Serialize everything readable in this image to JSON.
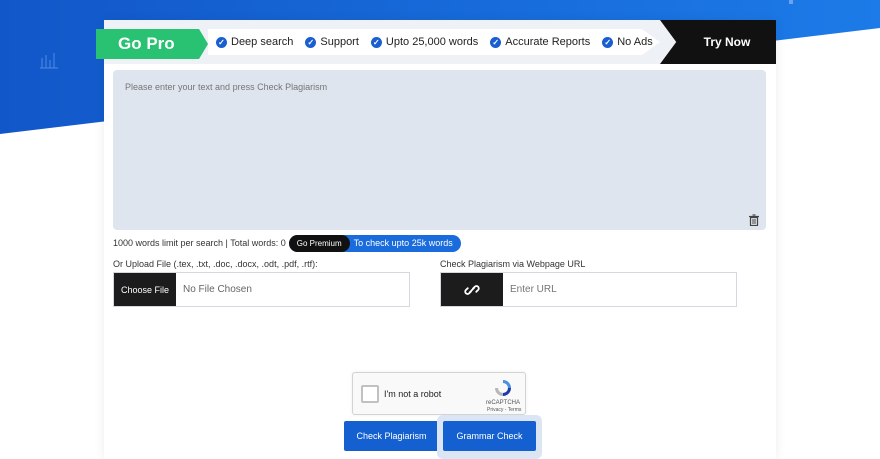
{
  "promo": {
    "go_pro_label": "Go Pro",
    "features": [
      {
        "label": "Deep search",
        "icon": "check-circle-icon"
      },
      {
        "label": "Support",
        "icon": "check-circle-icon"
      },
      {
        "label": "Upto 25,000 words",
        "icon": "check-circle-icon"
      },
      {
        "label": "Accurate Reports",
        "icon": "check-circle-icon"
      },
      {
        "label": "No Ads",
        "icon": "check-circle-icon"
      }
    ],
    "try_now_label": "Try Now"
  },
  "editor": {
    "placeholder": "Please enter your text and press Check Plagiarism",
    "value": "",
    "clear_icon": "trash-icon"
  },
  "limits": {
    "text": "1000 words limit per search | Total words: 0",
    "premium_label": "Go Premium",
    "premium_text": "To check upto 25k words"
  },
  "upload": {
    "label": "Or Upload File (.tex, .txt, .doc, .docx, .odt, .pdf, .rtf):",
    "button_label": "Choose File",
    "file_status": "No File Chosen"
  },
  "url_check": {
    "label": "Check Plagiarism via Webpage URL",
    "icon": "link-icon",
    "placeholder": "Enter URL",
    "value": ""
  },
  "captcha": {
    "label": "I'm not a robot",
    "brand": "reCAPTCHA",
    "links": "Privacy - Terms",
    "checked": false
  },
  "actions": {
    "check_plagiarism_label": "Check Plagiarism",
    "grammar_check_label": "Grammar Check"
  },
  "colors": {
    "brand_blue": "#1560d0",
    "go_pro_green": "#29c172",
    "editor_bg": "#dfe5ee",
    "dark": "#1c1c1c"
  }
}
